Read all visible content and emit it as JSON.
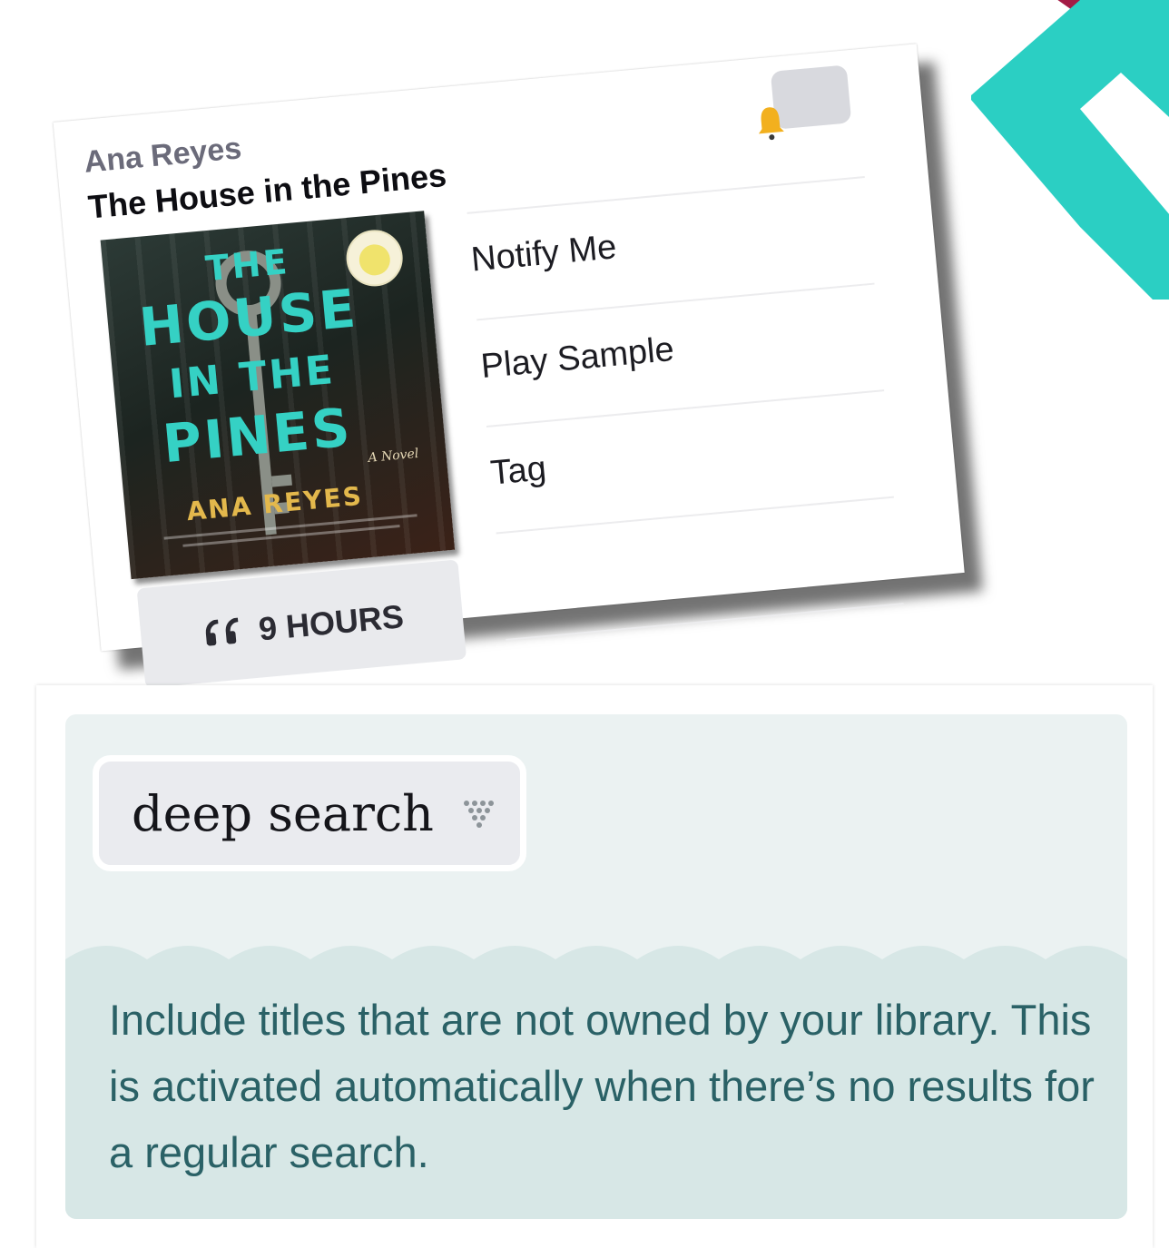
{
  "card": {
    "author": "Ana Reyes",
    "title": "The House in the Pines",
    "cover": {
      "line1": "THE",
      "line2": "HOUSE",
      "line3": "IN THE",
      "line4": "PINES",
      "author": "ANA REYES",
      "subtitle": "A Novel"
    },
    "duration": "9 HOURS",
    "actions": [
      "Notify Me",
      "Play Sample",
      "Tag"
    ]
  },
  "search": {
    "deep_search_label": "deep search",
    "help_text": "Include titles that are not owned by your library. This is activated automatically when there’s no results for a regular search."
  },
  "colors": {
    "teal_ribbon": "#2bcfc3",
    "maroon_ribbon": "#a31b45",
    "panel_background": "#ebf2f2",
    "help_text": "#2a6166",
    "cover_title": "#35d1c4",
    "bell": "#f2b01e"
  },
  "icons": {
    "bell": "bell-icon",
    "headphones": "headphones-icon",
    "deep_search": "funnel-dots-icon"
  }
}
